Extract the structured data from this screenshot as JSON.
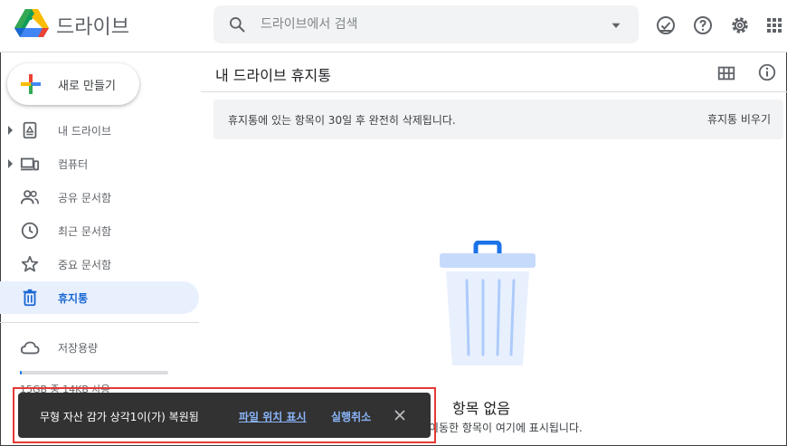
{
  "app": {
    "name": "드라이브"
  },
  "search": {
    "placeholder": "드라이브에서 검색"
  },
  "header_icons": [
    "offline-status-icon",
    "help-icon",
    "settings-icon",
    "apps-grid-icon"
  ],
  "sidebar": {
    "new_label": "새로 만들기",
    "items": [
      {
        "label": "내 드라이브",
        "icon": "my-drive-icon",
        "expandable": true
      },
      {
        "label": "컴퓨터",
        "icon": "computers-icon",
        "expandable": true
      },
      {
        "label": "공유 문서함",
        "icon": "shared-icon",
        "expandable": false
      },
      {
        "label": "최근 문서함",
        "icon": "clock-icon",
        "expandable": false
      },
      {
        "label": "중요 문서함",
        "icon": "star-icon",
        "expandable": false
      },
      {
        "label": "휴지통",
        "icon": "trash-icon",
        "expandable": false,
        "active": true
      }
    ],
    "storage_label": "저장용량",
    "storage_text": "15GB 중 14KB 사용"
  },
  "main": {
    "title": "내 드라이브 휴지통",
    "notice": "휴지통에 있는 항목이 30일 후 완전히 삭제됩니다.",
    "empty_trash_label": "휴지통 비우기",
    "empty_title": "항목 없음",
    "empty_subtitle": "이동한 항목이 여기에 표시됩니다."
  },
  "snackbar": {
    "message": "무형 자산 감가 상각1이(가) 복원됨",
    "link_label": "파일 위치 표시",
    "undo_label": "실행취소"
  },
  "colors": {
    "accent": "#1a73e8",
    "active_bg": "#e8f0fe",
    "snackbar_bg": "#323232",
    "snackbar_link": "#8ab4f8",
    "highlight_outline": "#e53935"
  }
}
